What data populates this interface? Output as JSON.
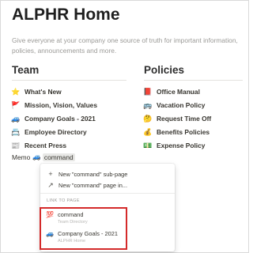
{
  "page": {
    "title": "ALPHR Home",
    "description": "Give everyone at your company one source of truth for important information, policies, announcements and more."
  },
  "team": {
    "heading": "Team",
    "items": [
      {
        "icon": "⭐",
        "label": "What's New"
      },
      {
        "icon": "🚩",
        "label": "Mission, Vision, Values"
      },
      {
        "icon": "🚙",
        "label": "Company Goals - 2021"
      },
      {
        "icon": "📇",
        "label": "Employee Directory"
      },
      {
        "icon": "📰",
        "label": "Recent Press"
      }
    ]
  },
  "policies": {
    "heading": "Policies",
    "items": [
      {
        "icon": "📕",
        "label": "Office Manual"
      },
      {
        "icon": "🚌",
        "label": "Vacation Policy"
      },
      {
        "icon": "🤔",
        "label": "Request Time Off"
      },
      {
        "icon": "💰",
        "label": "Benefits Policies"
      },
      {
        "icon": "💵",
        "label": "Expense Policy"
      }
    ]
  },
  "memo": {
    "prefix": "Memo",
    "icon": "🚙",
    "typed": "command"
  },
  "menu": {
    "options": [
      {
        "glyph": "+",
        "label": "New \"command\" sub-page"
      },
      {
        "glyph": "↗",
        "label": "New \"command\" page in..."
      }
    ],
    "section_label": "LINK TO PAGE",
    "results": [
      {
        "icon": "💯",
        "title": "command",
        "subtitle": "Team Directory"
      },
      {
        "icon": "🚙",
        "title": "Company Goals - 2021",
        "subtitle": "ALPHR Home"
      }
    ]
  },
  "colors": {
    "highlight_border": "#d42a2a",
    "muted_text": "#9b9a97"
  }
}
